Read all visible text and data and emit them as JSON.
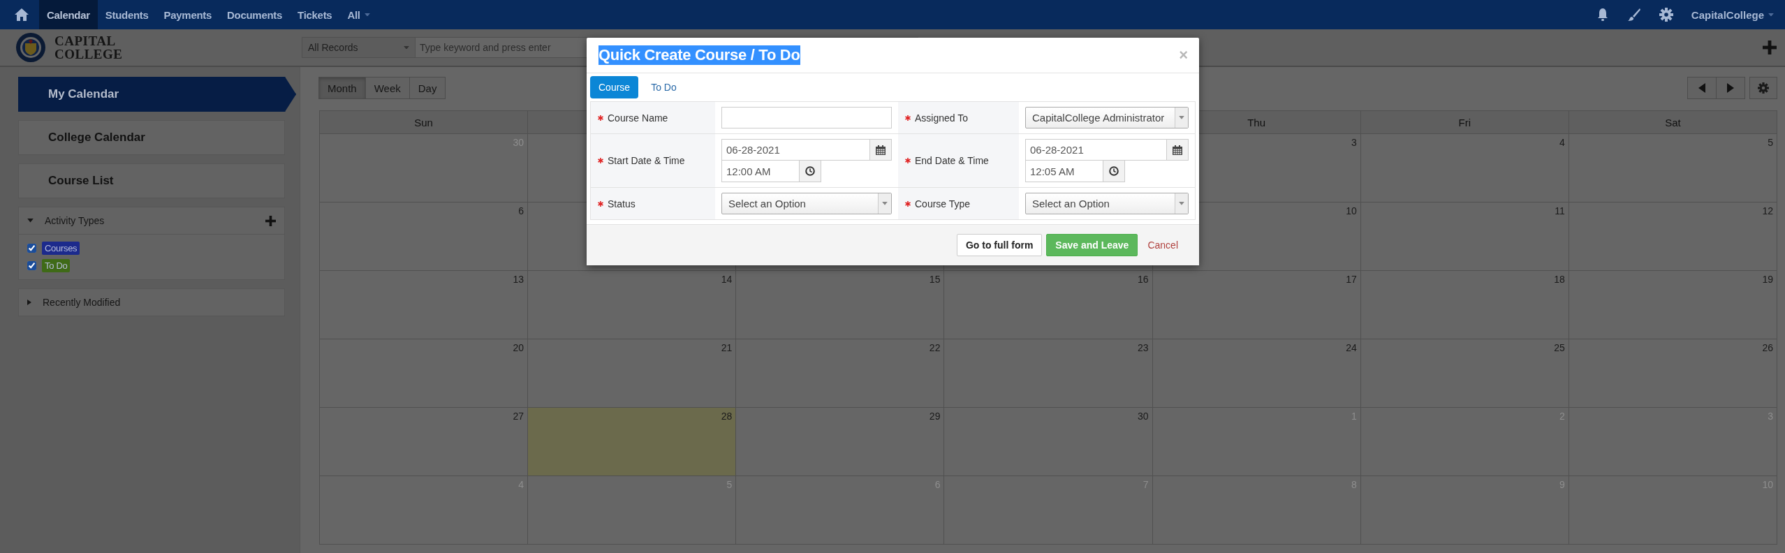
{
  "nav": {
    "items": [
      {
        "label": "Calendar",
        "selected": true,
        "dropdown": false
      },
      {
        "label": "Students",
        "selected": false,
        "dropdown": false
      },
      {
        "label": "Payments",
        "selected": false,
        "dropdown": false
      },
      {
        "label": "Documents",
        "selected": false,
        "dropdown": false
      },
      {
        "label": "Tickets",
        "selected": false,
        "dropdown": false
      },
      {
        "label": "All",
        "selected": false,
        "dropdown": true
      }
    ],
    "user": "CapitalCollege"
  },
  "brand": {
    "line1": "CAPITAL",
    "line2": "COLLEGE"
  },
  "search": {
    "scope": "All Records",
    "placeholder": "Type keyword and press enter"
  },
  "sidebar": {
    "items": [
      {
        "label": "My Calendar",
        "selected": true
      },
      {
        "label": "College Calendar",
        "selected": false
      },
      {
        "label": "Course List",
        "selected": false
      }
    ],
    "activity_types": {
      "title": "Activity Types",
      "expanded": true,
      "items": [
        {
          "label": "Courses",
          "checked": true,
          "color": "#1c2a8c"
        },
        {
          "label": "To Do",
          "checked": true,
          "color": "#3f6a17"
        }
      ]
    },
    "recently_modified": {
      "title": "Recently Modified",
      "expanded": false
    }
  },
  "view_buttons": [
    {
      "label": "Month",
      "selected": true
    },
    {
      "label": "Week",
      "selected": false
    },
    {
      "label": "Day",
      "selected": false
    }
  ],
  "calendar": {
    "headers": {
      "start": [
        "Sun"
      ],
      "end": [
        "Thu",
        "Fri",
        "Sat"
      ]
    },
    "weeks": [
      {
        "start": [
          {
            "day": "30",
            "other_month": true,
            "today": false
          }
        ],
        "end": [
          {
            "day": "3",
            "other_month": false,
            "today": false
          },
          {
            "day": "4",
            "other_month": false,
            "today": false
          },
          {
            "day": "5",
            "other_month": false,
            "today": false
          }
        ]
      },
      {
        "start": [
          {
            "day": "6",
            "other_month": false,
            "today": false
          }
        ],
        "end": [
          {
            "day": "10",
            "other_month": false,
            "today": false
          },
          {
            "day": "11",
            "other_month": false,
            "today": false
          },
          {
            "day": "12",
            "other_month": false,
            "today": false
          }
        ]
      },
      {
        "start": [
          {
            "day": "13",
            "other_month": false,
            "today": false
          },
          {
            "day": "14",
            "other_month": false,
            "today": false
          },
          {
            "day": "15",
            "other_month": false,
            "today": false
          },
          {
            "day": "16",
            "other_month": false,
            "today": false
          },
          {
            "day": "17",
            "other_month": false,
            "today": false
          },
          {
            "day": "18",
            "other_month": false,
            "today": false
          },
          {
            "day": "19",
            "other_month": false,
            "today": false
          }
        ]
      },
      {
        "start": [
          {
            "day": "20",
            "other_month": false,
            "today": false
          },
          {
            "day": "21",
            "other_month": false,
            "today": false
          },
          {
            "day": "22",
            "other_month": false,
            "today": false
          },
          {
            "day": "23",
            "other_month": false,
            "today": false
          },
          {
            "day": "24",
            "other_month": false,
            "today": false
          },
          {
            "day": "25",
            "other_month": false,
            "today": false
          },
          {
            "day": "26",
            "other_month": false,
            "today": false
          }
        ]
      },
      {
        "start": [
          {
            "day": "27",
            "other_month": false,
            "today": false
          },
          {
            "day": "28",
            "other_month": false,
            "today": true
          },
          {
            "day": "29",
            "other_month": false,
            "today": false
          },
          {
            "day": "30",
            "other_month": false,
            "today": false
          },
          {
            "day": "1",
            "other_month": true,
            "today": false
          },
          {
            "day": "2",
            "other_month": true,
            "today": false
          },
          {
            "day": "3",
            "other_month": true,
            "today": false
          }
        ]
      },
      {
        "start": [
          {
            "day": "4",
            "other_month": true,
            "today": false
          },
          {
            "day": "5",
            "other_month": true,
            "today": false
          },
          {
            "day": "6",
            "other_month": true,
            "today": false
          },
          {
            "day": "7",
            "other_month": true,
            "today": false
          },
          {
            "day": "8",
            "other_month": true,
            "today": false
          },
          {
            "day": "9",
            "other_month": true,
            "today": false
          },
          {
            "day": "10",
            "other_month": true,
            "today": false
          }
        ]
      }
    ]
  },
  "modal": {
    "title": "Quick Create Course / To Do",
    "title_highlighted": true,
    "close": "×",
    "tabs": [
      {
        "label": "Course",
        "selected": true
      },
      {
        "label": "To Do",
        "selected": false
      }
    ],
    "fields": [
      {
        "label": "Course Name",
        "required": true,
        "kind": "text"
      },
      {
        "label": "Assigned To",
        "required": true,
        "kind": "select",
        "value": "CapitalCollege Administrator"
      },
      {
        "label": "Start Date & Time",
        "required": true,
        "kind": "datetime",
        "date": "06-28-2021",
        "time": "12:00 AM"
      },
      {
        "label": "End Date & Time",
        "required": true,
        "kind": "datetime",
        "date": "06-28-2021",
        "time": "12:05 AM"
      },
      {
        "label": "Status",
        "required": true,
        "kind": "select",
        "value": "Select an Option"
      },
      {
        "label": "Course Type",
        "required": true,
        "kind": "select",
        "value": "Select an Option"
      }
    ],
    "buttons": [
      {
        "label": "Go to full form",
        "kind": "default"
      },
      {
        "label": "Save and Leave",
        "kind": "primary"
      },
      {
        "label": "Cancel",
        "kind": "link"
      }
    ]
  }
}
